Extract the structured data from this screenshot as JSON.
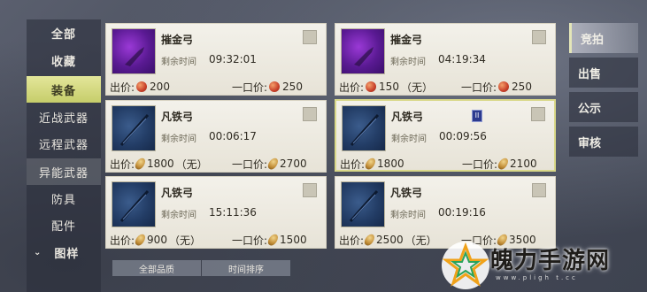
{
  "sidebar": {
    "items": [
      {
        "label": "全部",
        "state": "normal"
      },
      {
        "label": "收藏",
        "state": "normal"
      },
      {
        "label": "装备",
        "state": "active"
      },
      {
        "label": "近战武器",
        "state": "sub"
      },
      {
        "label": "远程武器",
        "state": "sub"
      },
      {
        "label": "异能武器",
        "state": "sub-active"
      },
      {
        "label": "防具",
        "state": "sub"
      },
      {
        "label": "配件",
        "state": "sub"
      },
      {
        "label": "图样",
        "state": "group"
      }
    ]
  },
  "labels": {
    "timer": "剩余时间",
    "price": "出价:",
    "buyout": "一口价:"
  },
  "listings": [
    {
      "name": "摧金弓",
      "time": "09:32:01",
      "price": "200",
      "price_suffix": "",
      "buyout": "250",
      "currency": "red",
      "art": "purple"
    },
    {
      "name": "摧金弓",
      "time": "04:19:34",
      "price": "150",
      "price_suffix": "（无）",
      "buyout": "250",
      "currency": "red",
      "art": "purple"
    },
    {
      "name": "凡铁弓",
      "time": "00:06:17",
      "price": "1800",
      "price_suffix": "（无）",
      "buyout": "2700",
      "currency": "gold",
      "art": "blue"
    },
    {
      "name": "凡铁弓",
      "time": "00:09:56",
      "price": "1800",
      "price_suffix": "",
      "buyout": "2100",
      "currency": "gold",
      "art": "blue",
      "badge": "II"
    },
    {
      "name": "凡铁弓",
      "time": "15:11:36",
      "price": "900",
      "price_suffix": "（无）",
      "buyout": "1500",
      "currency": "gold",
      "art": "blue"
    },
    {
      "name": "凡铁弓",
      "time": "00:19:16",
      "price": "2500",
      "price_suffix": "（无）",
      "buyout": "3500",
      "currency": "gold",
      "art": "blue"
    }
  ],
  "right_tabs": [
    {
      "label": "竞拍",
      "active": true
    },
    {
      "label": "出售",
      "active": false
    },
    {
      "label": "公示",
      "active": false
    },
    {
      "label": "审核",
      "active": false
    }
  ],
  "filters": {
    "quality": "全部品质",
    "sort": "时间排序"
  },
  "watermark": {
    "text": "魄力手游网",
    "sub": "www.pligh t.cc"
  },
  "colors": {
    "active_tab": "#c6cd6a",
    "card_bg": "#f0eee6",
    "selected_border": "#d9d889"
  }
}
